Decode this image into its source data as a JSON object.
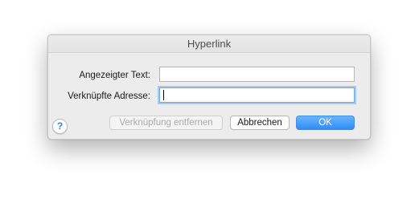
{
  "dialog": {
    "title": "Hyperlink",
    "fields": {
      "display_text": {
        "label": "Angezeigter Text:",
        "value": "",
        "placeholder": ""
      },
      "linked_address": {
        "label": "Verknüpfte Adresse:",
        "value": "",
        "placeholder": ""
      }
    },
    "buttons": {
      "remove_link": "Verknüpfung entfernen",
      "cancel": "Abbrechen",
      "ok": "OK"
    },
    "help_glyph": "?",
    "help_icon": "help-icon"
  },
  "colors": {
    "dialog_bg": "#ececec",
    "primary_button": "#2d8ef6",
    "focus_ring": "#a8c9f2",
    "help_glyph": "#2f7fe2"
  }
}
